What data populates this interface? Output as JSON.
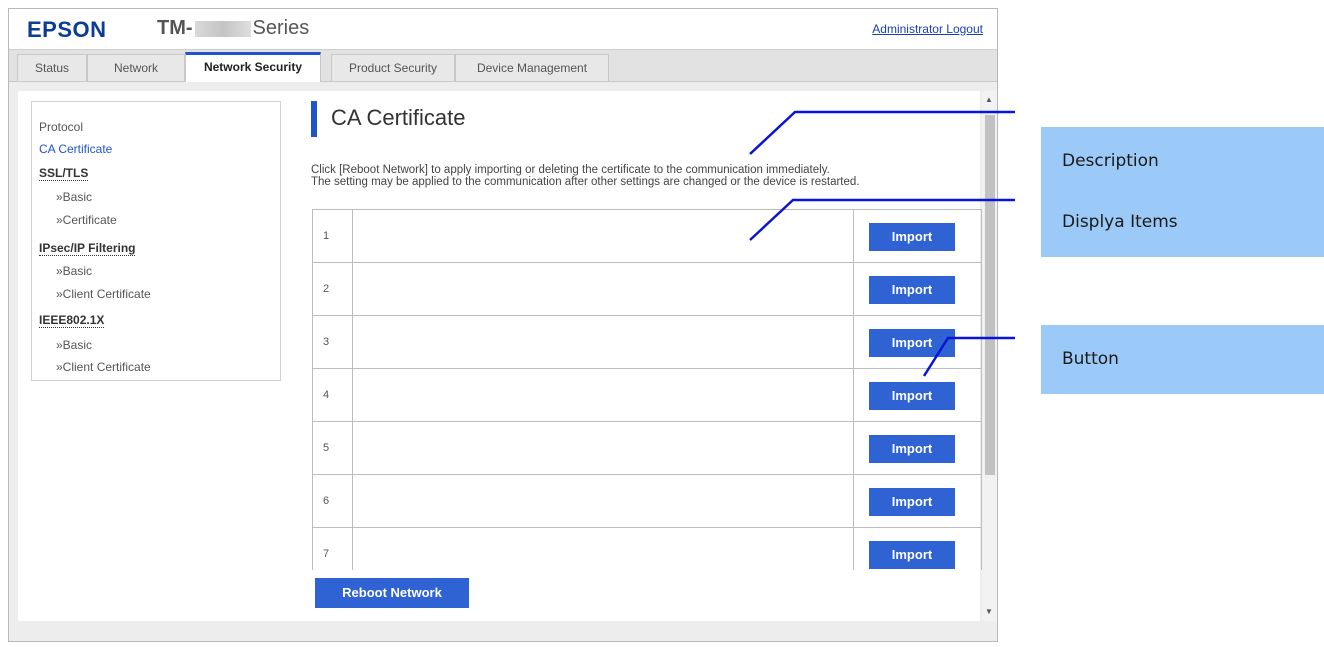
{
  "header": {
    "brand": "EPSON",
    "model_prefix": "TM-",
    "model_suffix": "Series",
    "logout_label": "Administrator Logout"
  },
  "tabs": [
    {
      "label": "Status"
    },
    {
      "label": "Network"
    },
    {
      "label": "Network Security",
      "active": true
    },
    {
      "label": "Product Security"
    },
    {
      "label": "Device Management"
    }
  ],
  "sidebar": {
    "protocol": "Protocol",
    "ca_certificate": "CA Certificate",
    "ssl_tls": "SSL/TLS",
    "ssl_basic": "»Basic",
    "ssl_certificate": "»Certificate",
    "ipsec": "IPsec/IP Filtering",
    "ipsec_basic": "»Basic",
    "ipsec_client_cert": "»Client Certificate",
    "ieee": "IEEE802.1X",
    "ieee_basic": "»Basic",
    "ieee_client_cert": "»Client Certificate"
  },
  "main": {
    "title": "CA Certificate",
    "description_line1": "Click [Reboot Network] to apply importing or deleting the certificate to the communication immediately.",
    "description_line2": "The setting may be applied to the communication after other settings are changed or the device is restarted.",
    "rows": [
      {
        "num": "1",
        "button": "Import"
      },
      {
        "num": "2",
        "button": "Import"
      },
      {
        "num": "3",
        "button": "Import"
      },
      {
        "num": "4",
        "button": "Import"
      },
      {
        "num": "5",
        "button": "Import"
      },
      {
        "num": "6",
        "button": "Import"
      },
      {
        "num": "7",
        "button": "Import"
      }
    ],
    "reboot_label": "Reboot Network"
  },
  "callouts": {
    "description": "Description",
    "display_items": "Displya Items",
    "button": "Button"
  },
  "colors": {
    "accent": "#1f55c9",
    "button": "#2f62d3",
    "callout": "#9ccaf8",
    "annotation_line": "#0a14d8"
  }
}
